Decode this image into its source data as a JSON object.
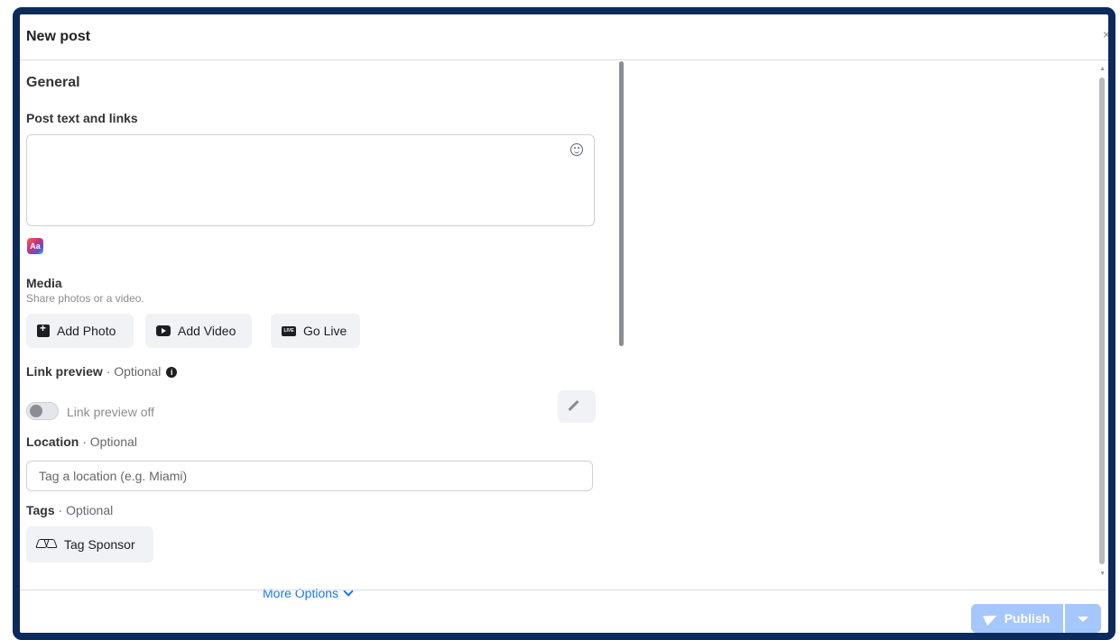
{
  "dialog": {
    "title": "New post",
    "close_glyph": "×"
  },
  "general": {
    "section_title": "General",
    "post_text_label": "Post text and links",
    "ai_icon_label": "Aa"
  },
  "media": {
    "label": "Media",
    "hint": "Share photos or a video.",
    "add_photo": "Add Photo",
    "add_video": "Add Video",
    "go_live": "Go Live",
    "live_icon_text": "LIVE"
  },
  "link_preview": {
    "label": "Link preview",
    "optional": " · Optional",
    "info_glyph": "i",
    "toggle_label": "Link preview off"
  },
  "location": {
    "label": "Location",
    "optional": " · Optional",
    "placeholder": "Tag a location (e.g. Miami)"
  },
  "tags": {
    "label": "Tags",
    "optional": " · Optional",
    "tag_sponsor": "Tag Sponsor"
  },
  "more_options": "More Options",
  "footer": {
    "publish": "Publish"
  },
  "colors": {
    "frame_border": "#0d2a5c",
    "link": "#1877f2",
    "publish_disabled": "#a5c7fb"
  }
}
